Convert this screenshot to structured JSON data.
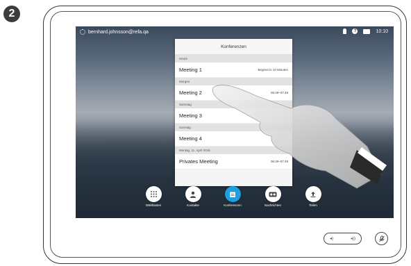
{
  "step": "2",
  "status": {
    "user": "bernhard.johnsson@refa.qa",
    "time": "10:10"
  },
  "panel": {
    "title": "Konferenzen",
    "sections": [
      {
        "label": "Heute",
        "item": "Meeting 1",
        "note": "Beginnt in 10 Minuten"
      },
      {
        "label": "Morgen",
        "item": "Meeting 2",
        "note": "06:49–07:49"
      },
      {
        "label": "Samstag",
        "item": "Meeting 3",
        "note": ""
      },
      {
        "label": "Sonntag",
        "item": "Meeting 4",
        "note": ""
      },
      {
        "label": "Montag, 11. April 2016",
        "item": "Privates Meeting",
        "note": "06:49–07:49"
      }
    ]
  },
  "toolbar": {
    "dial": "Wähltasten",
    "contacts": "Kontakte",
    "meetings": "Konferenzen",
    "messages": "Nachrichten",
    "share": "Teilen"
  },
  "colors": {
    "accent": "#1e9fe0"
  }
}
